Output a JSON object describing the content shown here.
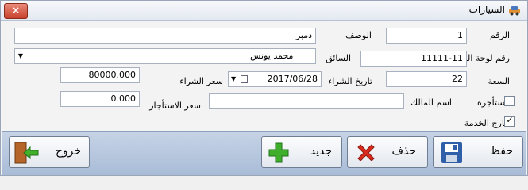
{
  "window": {
    "title": "السيارات"
  },
  "labels": {
    "number": "الرقم",
    "description": "الوصف",
    "plate": "رقم لوحة السيارة",
    "driver": "السائق",
    "capacity": "السعة",
    "purchase_date": "تاريخ الشراء",
    "purchase_price": "سعر الشراء",
    "rented": "مستأجرة",
    "owner_name": "اسم المالك",
    "rent_price": "سعر الاستأجار",
    "out_of_service": "خارج الخدمة"
  },
  "values": {
    "number": "1",
    "description": "دمبر",
    "plate": "11111-11",
    "driver": "محمد يونس",
    "capacity": "22",
    "purchase_date": "2017/06/28",
    "purchase_price": "80000.000",
    "owner_name": "",
    "rent_price": "0.000",
    "rented_checked": false,
    "out_of_service_checked": true
  },
  "buttons": {
    "save": "حفظ",
    "delete": "حذف",
    "new": "جديد",
    "exit": "خروج"
  },
  "icons": {
    "close": "×",
    "check": "✓",
    "dropdown": "▼"
  }
}
